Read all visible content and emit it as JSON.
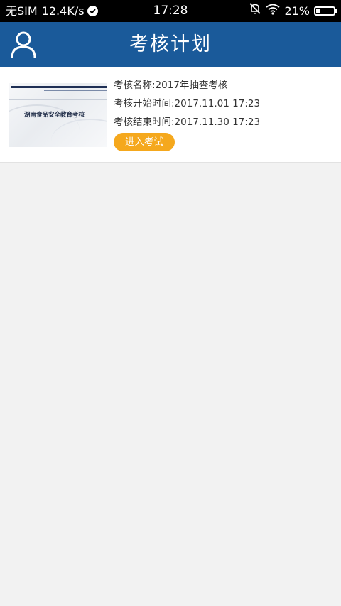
{
  "status_bar": {
    "carrier": "无SIM",
    "net_speed": "12.4K/s",
    "time": "17:28",
    "battery_percent": "21%",
    "battery_level": 0.21,
    "icons": [
      "check-circle-icon",
      "bell-off-icon",
      "wifi-icon",
      "battery-icon"
    ]
  },
  "header": {
    "title": "考核计划",
    "user_icon": "user-icon",
    "background": "#1a5a9a"
  },
  "exams": [
    {
      "thumb_caption": "湖南食品安全教育考核",
      "name_line": "考核名称:2017年抽查考核",
      "start_line": "考核开始时间:2017.11.01 17:23",
      "end_line": "考核结束时间:2017.11.30 17:23",
      "enter_label": "进入考试",
      "button_color": "#f5a81d"
    }
  ]
}
